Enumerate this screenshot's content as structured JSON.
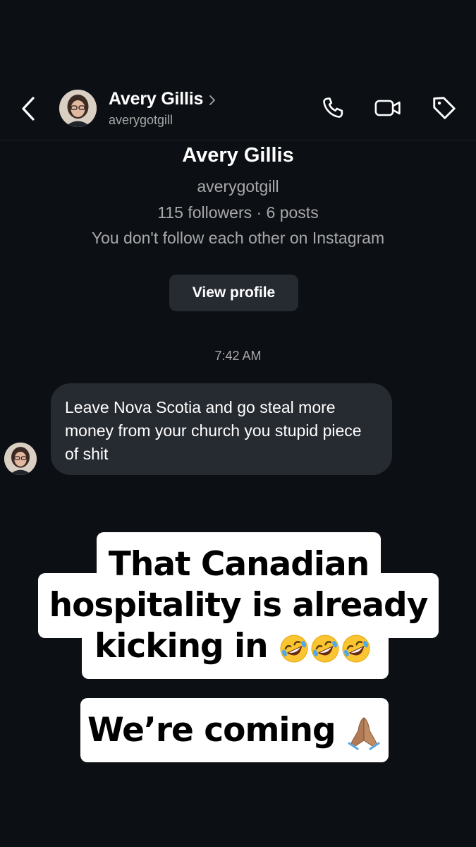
{
  "header": {
    "name": "Avery Gillis",
    "username": "averygotgill",
    "icons": [
      "chevron-left-icon",
      "phone-icon",
      "video-icon",
      "tag-icon"
    ]
  },
  "profile_card": {
    "name": "Avery Gillis",
    "username": "averygotgill",
    "stats": "115 followers · 6 posts",
    "follow_note": "You don't follow each other on Instagram",
    "button_label": "View profile"
  },
  "thread": {
    "timestamp": "7:42 AM",
    "messages": [
      {
        "sender": "Avery Gillis",
        "text": "Leave Nova Scotia and go steal more money from your church you stupid piece of shit"
      }
    ]
  },
  "overlay_captions": {
    "caption_1_lines": [
      "That Canadian",
      "hospitality is already",
      "kicking in"
    ],
    "caption_1_emoji": [
      "rolling-on-floor-laughing-emoji",
      "rolling-on-floor-laughing-emoji",
      "rolling-on-floor-laughing-emoji"
    ],
    "caption_2": "We’re coming",
    "caption_2_emoji": "folded-hands-emoji"
  },
  "colors": {
    "background": "#0c0f14",
    "bubble": "#262a31",
    "secondary_text": "#a8a8a8",
    "caption_bg": "#ffffff"
  }
}
